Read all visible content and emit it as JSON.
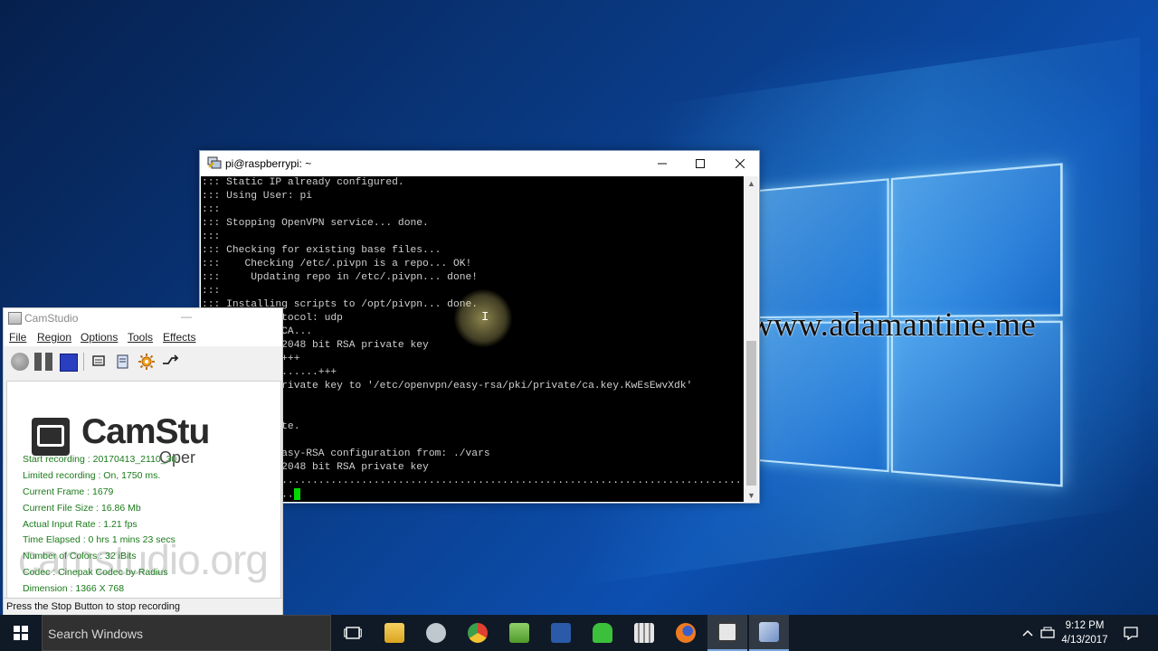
{
  "watermark": "www.adamantine.me",
  "putty": {
    "title": "pi@raspberrypi: ~",
    "lines": [
      "::: Static IP already configured.",
      "::: Using User: pi",
      ":::",
      "::: Stopping OpenVPN service... done.",
      ":::",
      "::: Checking for existing base files...",
      ":::    Checking /etc/.pivpn is a repo... OK!",
      ":::     Updating repo in /etc/.pivpn... done!",
      ":::",
      "::: Installing scripts to /opt/pivpn... done.",
      "::: Using protocol: udp",
      "::: Building CA...",
      "Generating a 2048 bit RSA private key",
      ".............+++",
      "...................+++",
      "writing new private key to '/etc/openvpn/easy-rsa/pki/private/ca.key.KwEsEwvXdk'",
      "-----",
      "",
      "::: CA Complete.",
      "",
      "Note: using Easy-RSA configuration from: ./vars",
      "Generating a 2048 bit RSA private key",
      "...............................................................................................",
      "..............."
    ]
  },
  "camstudio": {
    "title": "CamStudio",
    "menu": [
      "File",
      "Region",
      "Options",
      "Tools",
      "Effects"
    ],
    "logo_text": "CamStu",
    "logo_sub": "Oper",
    "site_text": "camstudio.org",
    "stats": [
      "Start recording : 20170413_2110_30",
      "Limited recording : On, 1750 ms.",
      "Current Frame : 1679",
      "Current File Size : 16.86 Mb",
      "Actual Input Rate : 1.21 fps",
      "Time Elapsed : 0 hrs 1 mins 23 secs",
      "Number of Colors : 32 iBits",
      "Codec : Cinepak Codec by Radius",
      "Dimension : 1366 X 768"
    ],
    "status": "Press the Stop Button to stop recording"
  },
  "taskbar": {
    "search_placeholder": "Search Windows",
    "apps": [
      {
        "name": "task-view-icon",
        "color": "#ffffff"
      },
      {
        "name": "file-explorer-icon",
        "color": "#f0c040"
      },
      {
        "name": "settings-app-icon",
        "color": "#cfcfcf"
      },
      {
        "name": "chrome-icon",
        "color": "#e04030"
      },
      {
        "name": "notepad-plus-icon",
        "color": "#5fa83a"
      },
      {
        "name": "powershell-icon",
        "color": "#2a5aa8"
      },
      {
        "name": "android-icon",
        "color": "#40c040"
      },
      {
        "name": "calculator-icon",
        "color": "#e0e0e0"
      },
      {
        "name": "firefox-icon",
        "color": "#f07a20"
      },
      {
        "name": "camstudio-icon",
        "color": "#dddddd"
      },
      {
        "name": "putty-icon",
        "color": "#8aa8d8"
      }
    ],
    "time": "9:12 PM",
    "date": "4/13/2017"
  }
}
